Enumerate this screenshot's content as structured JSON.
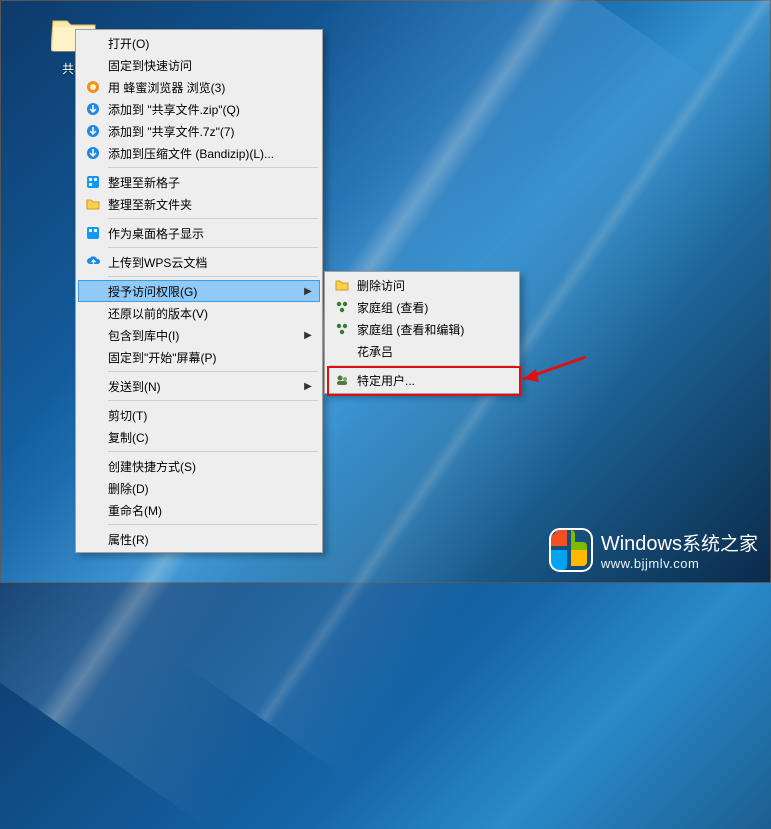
{
  "desktop": {
    "folder_label": "共享"
  },
  "menu": {
    "open": "打开(O)",
    "pin_quick": "固定到快速访问",
    "browse_with": "用 蜂蜜浏览器 浏览(3)",
    "add_zip": "添加到 \"共享文件.zip\"(Q)",
    "add_7z": "添加到 \"共享文件.7z\"(7)",
    "add_archive": "添加到压缩文件 (Bandizip)(L)...",
    "fence_tidy": "整理至新格子",
    "folder_tidy": "整理至新文件夹",
    "fence_show": "作为桌面格子显示",
    "upload_wps": "上传到WPS云文档",
    "grant_access": "授予访问权限(G)",
    "restore_prev": "还原以前的版本(V)",
    "include_lib": "包含到库中(I)",
    "pin_start": "固定到\"开始\"屏幕(P)",
    "send_to": "发送到(N)",
    "cut": "剪切(T)",
    "copy": "复制(C)",
    "shortcut": "创建快捷方式(S)",
    "delete": "删除(D)",
    "rename": "重命名(M)",
    "properties": "属性(R)"
  },
  "submenu": {
    "remove_access": "删除访问",
    "homegroup_view": "家庭组 (查看)",
    "homegroup_edit": "家庭组 (查看和编辑)",
    "user1": "花承吕",
    "specific_users": "特定用户..."
  },
  "watermark": {
    "brand": "Windows",
    "suffix": "系统之家",
    "url": "www.bjjmlv.com"
  },
  "colors": {
    "menu_bg": "#eeeeee",
    "menu_border": "#a0a0a0",
    "hover_bg": "#91c9f7",
    "hover_border": "#3a9be8",
    "annotation": "#d11"
  }
}
